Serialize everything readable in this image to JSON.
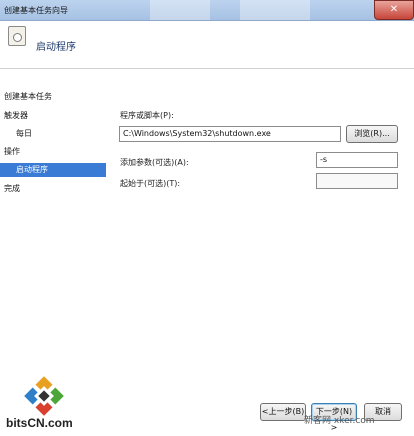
{
  "window": {
    "title": "创建基本任务向导",
    "close_label": "✕"
  },
  "header": {
    "title": "启动程序",
    "icon": "task-clock-icon"
  },
  "sidebar": {
    "section_label": "创建基本任务",
    "items": [
      {
        "label": "触发器"
      },
      {
        "label": "每日"
      },
      {
        "label": "操作"
      },
      {
        "label": "启动程序"
      },
      {
        "label": "完成"
      }
    ]
  },
  "main": {
    "program_label": "程序或脚本(P):",
    "program_value": "C:\\Windows\\System32\\shutdown.exe",
    "browse_label": "浏览(R)...",
    "args_label": "添加参数(可选)(A):",
    "args_value": "-s",
    "startin_label": "起始于(可选)(T):",
    "startin_value": ""
  },
  "footer": {
    "back_label": "<上一步(B)",
    "next_label": "下一步(N) >",
    "cancel_label": "取消"
  },
  "logo": {
    "text": "bitsCN.com"
  },
  "watermark": {
    "text": "新客网 xker.com"
  }
}
